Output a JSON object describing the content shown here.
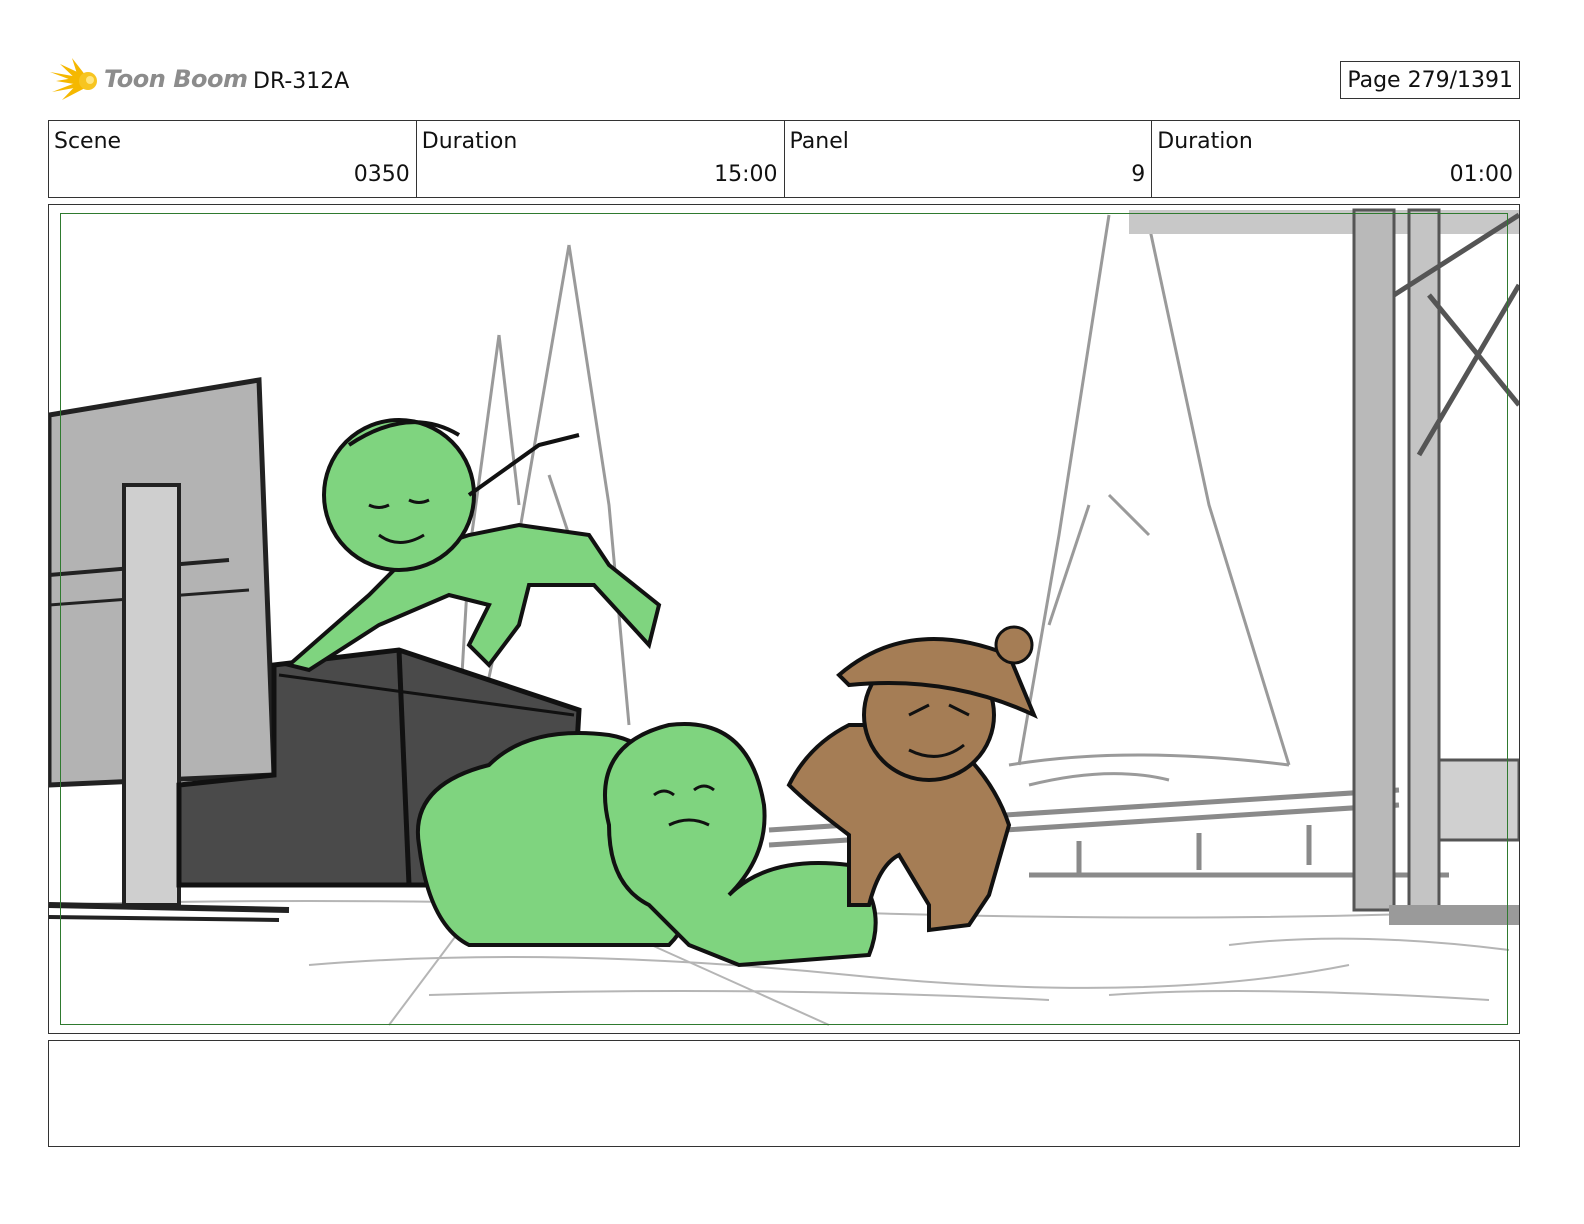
{
  "header": {
    "logo_text": "Toon Boom",
    "project_code": "DR-312A",
    "page_label": "Page",
    "page_value": "279/1391"
  },
  "info": {
    "scene_label": "Scene",
    "scene_value": "0350",
    "scene_duration_label": "Duration",
    "scene_duration_value": "15:00",
    "panel_label": "Panel",
    "panel_value": "9",
    "panel_duration_label": "Duration",
    "panel_duration_value": "01:00"
  },
  "colors": {
    "accent_green": "#2f7a2f",
    "character_green": "#7fd47f",
    "character_brown": "#a57d55",
    "logo_yellow": "#f5b800"
  },
  "notes": {
    "text": ""
  }
}
